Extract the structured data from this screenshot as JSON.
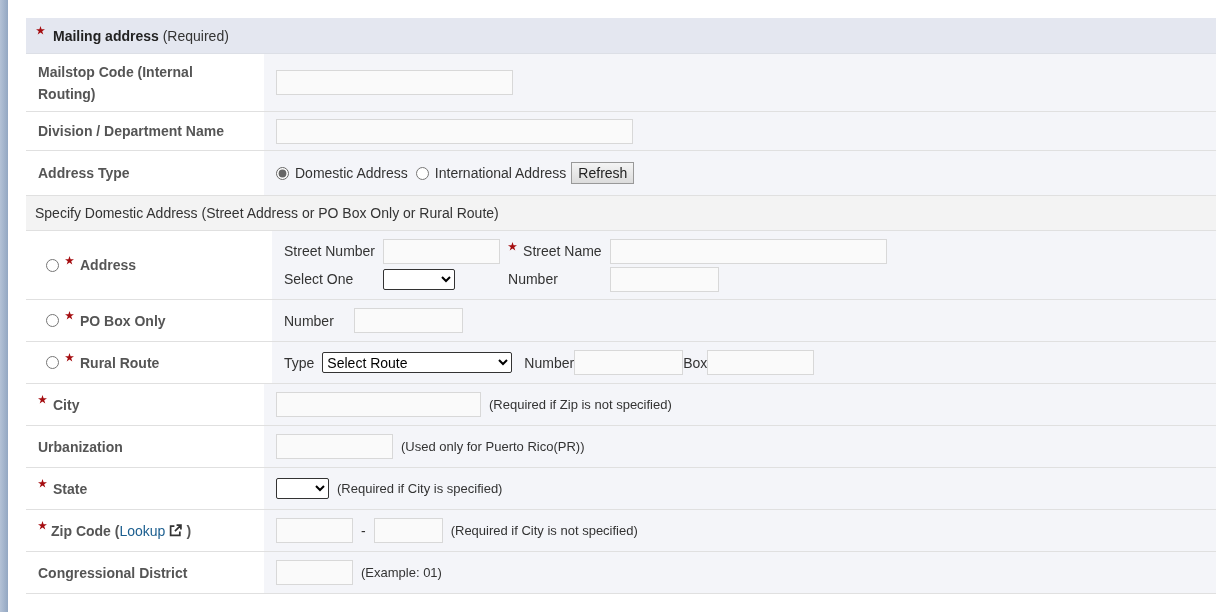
{
  "mailing_address": {
    "title": "Mailing address",
    "note": "(Required)",
    "required": true
  },
  "mailstop_code": {
    "label": "Mailstop Code (Internal Routing)"
  },
  "division": {
    "label": "Division / Department Name"
  },
  "address_type": {
    "label": "Address Type",
    "options": [
      {
        "label": "Domestic Address",
        "selected": true
      },
      {
        "label": "International Address",
        "selected": false
      }
    ],
    "button": "Refresh"
  },
  "domestic_heading": "Specify Domestic Address (Street Address or PO Box Only or Rural Route)",
  "address_choices": [
    {
      "kind": "street",
      "label": "Address",
      "selected": false,
      "required": true,
      "street_number_label": "Street Number",
      "street_name_label": "Street Name",
      "street_name_required": true,
      "select_one_label": "Select One",
      "number_label": "Number"
    },
    {
      "kind": "po_box",
      "label": "PO Box Only",
      "selected": false,
      "required": true,
      "number_label": "Number"
    },
    {
      "kind": "rural",
      "label": "Rural Route",
      "selected": false,
      "required": true,
      "type_label": "Type",
      "route_select": "Select Route",
      "number_label": "Number",
      "box_label": "Box"
    }
  ],
  "city": {
    "label": "City",
    "required": true,
    "hint": "(Required if Zip is not specified)"
  },
  "urbanization": {
    "label": "Urbanization",
    "hint": "(Used only for Puerto Rico(PR))"
  },
  "state": {
    "label": "State",
    "required": true,
    "hint": "(Required if City is specified)"
  },
  "zip_code": {
    "label": "Zip Code (",
    "link": "Lookup",
    "close": ")",
    "required": true,
    "separator": "-",
    "hint": "(Required if City is not specified)"
  },
  "congressional_district": {
    "label": "Congressional District",
    "hint": "(Example: 01)"
  }
}
